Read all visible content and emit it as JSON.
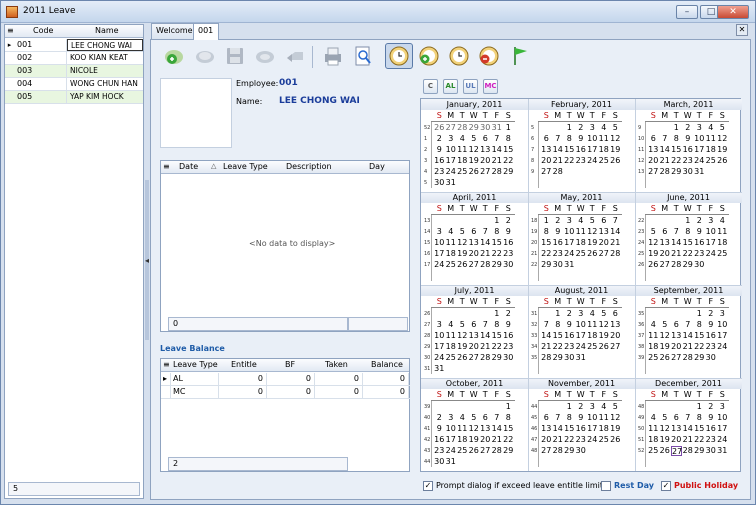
{
  "window": {
    "title": "2011 Leave",
    "minimize": "–",
    "maximize": "□",
    "close": "✕"
  },
  "employees_grid": {
    "headers": {
      "indicator": "≡",
      "code": "Code",
      "name": "Name"
    },
    "rows": [
      {
        "code": "001",
        "name": "LEE CHONG WAI",
        "indicator": "▸"
      },
      {
        "code": "002",
        "name": "KOO KIAN KEAT",
        "indicator": ""
      },
      {
        "code": "003",
        "name": "NICOLE",
        "indicator": ""
      },
      {
        "code": "004",
        "name": "WONG CHUN HAN",
        "indicator": ""
      },
      {
        "code": "005",
        "name": "YAP KIM HOCK",
        "indicator": ""
      }
    ],
    "footer_count": "5"
  },
  "tabs": [
    {
      "label": "Welcome"
    },
    {
      "label": "001"
    }
  ],
  "tab_close": "✕",
  "toolbar_icons": [
    "add-icon",
    "hand-icon",
    "save-icon",
    "undo-hand-icon",
    "reply-icon",
    "print-icon",
    "preview-icon",
    "leave-clock-icon",
    "add-clock-icon",
    "clock-icon",
    "remove-clock-icon",
    "flag-icon"
  ],
  "employee": {
    "employee_label": "Employee:",
    "employee_value": "001",
    "name_label": "Name:",
    "name_value": "LEE CHONG WAI"
  },
  "leave_grid": {
    "headers": {
      "indicator": "≡",
      "date": "Date",
      "sort": "△",
      "leave_type": "Leave Type",
      "description": "Description",
      "day": "Day"
    },
    "empty_text": "<No data to display>",
    "footer_count": "0"
  },
  "leave_balance": {
    "title": "Leave Balance",
    "headers": {
      "indicator": "≡",
      "leave_type": "Leave Type",
      "entitle": "Entitle",
      "bf": "BF",
      "taken": "Taken",
      "balance": "Balance"
    },
    "rows": [
      {
        "indicator": "▸",
        "leave_type": "AL",
        "entitle": "0",
        "bf": "0",
        "taken": "0",
        "balance": "0"
      },
      {
        "indicator": "",
        "leave_type": "MC",
        "entitle": "0",
        "bf": "0",
        "taken": "0",
        "balance": "0"
      }
    ],
    "footer_count": "2"
  },
  "leave_type_buttons": [
    {
      "label": "C",
      "color": "#555555"
    },
    {
      "label": "AL",
      "color": "#2a8a2a"
    },
    {
      "label": "UL",
      "color": "#5a7ab8"
    },
    {
      "label": "MC",
      "color": "#d020c0"
    }
  ],
  "calendar": {
    "year": 2011,
    "prev_arrow": "◂",
    "next_arrow": "▸",
    "dow": [
      "S",
      "M",
      "T",
      "W",
      "T",
      "F",
      "S"
    ],
    "months": [
      "January, 2011",
      "February, 2011",
      "March, 2011",
      "April, 2011",
      "May, 2011",
      "June, 2011",
      "July, 2011",
      "August, 2011",
      "September, 2011",
      "October, 2011",
      "November, 2011",
      "December, 2011"
    ],
    "today": "2011-12-27"
  },
  "options": {
    "prompt_checked": "✓",
    "prompt_label": "Prompt dialog if exceed leave entitle limit",
    "rest_day_label": "Rest Day",
    "rest_day_color": "#1f5ca8",
    "public_holiday_checked": "✓",
    "public_holiday_label": "Public Holiday",
    "public_holiday_color": "#d01010"
  }
}
